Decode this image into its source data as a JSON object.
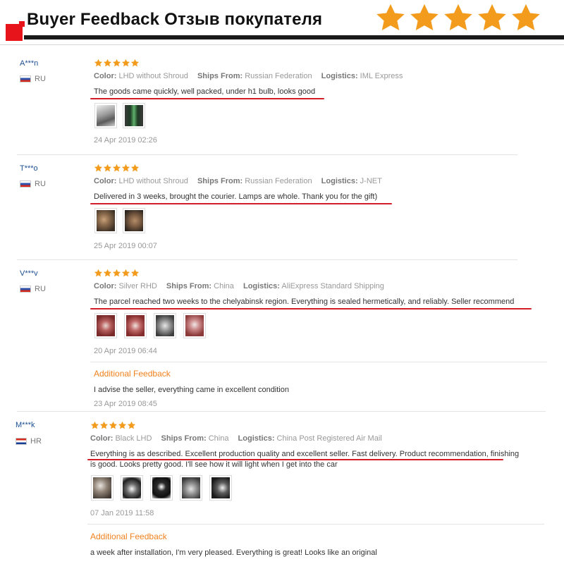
{
  "header": {
    "title": "Buyer Feedback Отзыв покупателя",
    "rating_stars": 5,
    "colors": {
      "accent_red": "#e8141c",
      "star_orange": "#f39b1c"
    }
  },
  "labels": {
    "color": "Color:",
    "ships_from": "Ships From:",
    "logistics": "Logistics:",
    "additional_feedback": "Additional Feedback"
  },
  "reviews": [
    {
      "user": "A***n",
      "country": "RU",
      "rating": 5,
      "color": "LHD without Shroud",
      "ships_from": "Russian Federation",
      "logistics": "IML Express",
      "text": "The goods came quickly, well packed, under h1 bulb, looks good",
      "photos": [
        "product-photo",
        "product-photo"
      ],
      "date": "24 Apr 2019 02:26"
    },
    {
      "user": "T***o",
      "country": "RU",
      "rating": 5,
      "color": "LHD without Shroud",
      "ships_from": "Russian Federation",
      "logistics": "J-NET",
      "text": "Delivered in 3 weeks, brought the courier. Lamps are whole. Thank you for the gift)",
      "photos": [
        "product-photo",
        "product-photo"
      ],
      "date": "25 Apr 2019 00:07"
    },
    {
      "user": "V***v",
      "country": "RU",
      "rating": 5,
      "color": "Silver RHD",
      "ships_from": "China",
      "logistics": "AliExpress Standard Shipping",
      "text": "The parcel reached two weeks to the chelyabinsk region. Everything is sealed hermetically, and reliably. Seller recommend",
      "photos": [
        "product-photo",
        "product-photo",
        "product-photo",
        "product-photo"
      ],
      "date": "20 Apr 2019 06:44",
      "additional": {
        "text": "I advise the seller, everything came in excellent condition",
        "date": "23 Apr 2019 08:45"
      }
    },
    {
      "user": "M***k",
      "country": "HR",
      "rating": 5,
      "color": "Black LHD",
      "ships_from": "China",
      "logistics": "China Post Registered Air Mail",
      "text_line1": "Everything is as described. Excellent production quality and excellent seller. Fast delivery. Product recommendation, finishing",
      "text_line2": "is good. Looks pretty good. I'll see how it will light when I get into the car",
      "photos": [
        "product-photo",
        "product-photo",
        "product-photo",
        "product-photo",
        "product-photo"
      ],
      "date": "07 Jan 2019 11:58",
      "additional": {
        "text": "a week after installation, I'm very pleased. Everything is great! Looks like an original"
      }
    }
  ]
}
